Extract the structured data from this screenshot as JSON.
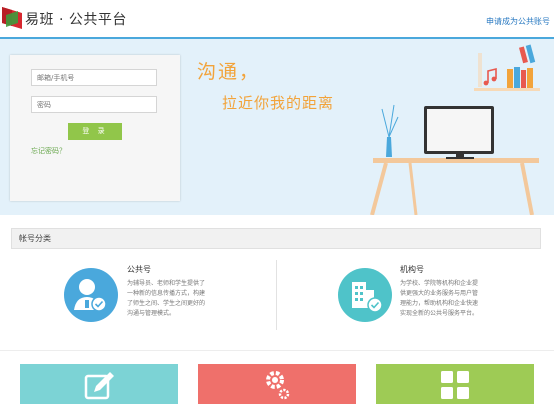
{
  "header": {
    "brand": "易班 · 公共平台",
    "apply_link": "申请成为公共账号"
  },
  "login": {
    "account_placeholder": "邮箱/手机号",
    "password_placeholder": "密码",
    "login_button": "登 录",
    "forgot_link": "忘记密码？"
  },
  "hero": {
    "slogan_line1": "沟通，",
    "slogan_line2": "拉近你我的距离"
  },
  "account_types": {
    "heading": "帐号分类",
    "public": {
      "title": "公共号",
      "lines": [
        "为辅导员、老师和学生提供了",
        "一种新的信息传播方式，构建",
        "了师生之间、学生之间更好的",
        "沟通与管理模式。"
      ]
    },
    "org": {
      "title": "机构号",
      "lines": [
        "为学校、学院等机构和企业提",
        "供更强大的业务服务与用户管",
        "理能力，帮助机构和企业快速",
        "实现全新的公共号服务平台。"
      ]
    }
  },
  "tiles": [
    {
      "name": "edit",
      "icon": "edit-icon",
      "color": "#7cd3d5"
    },
    {
      "name": "settings",
      "icon": "gear-icon",
      "color": "#ef706b"
    },
    {
      "name": "apps",
      "icon": "grid-icon",
      "color": "#9ecb55"
    }
  ],
  "colors": {
    "accent": "#4aa8dc",
    "slogan": "#f2a33a",
    "login_button": "#91c64a"
  }
}
